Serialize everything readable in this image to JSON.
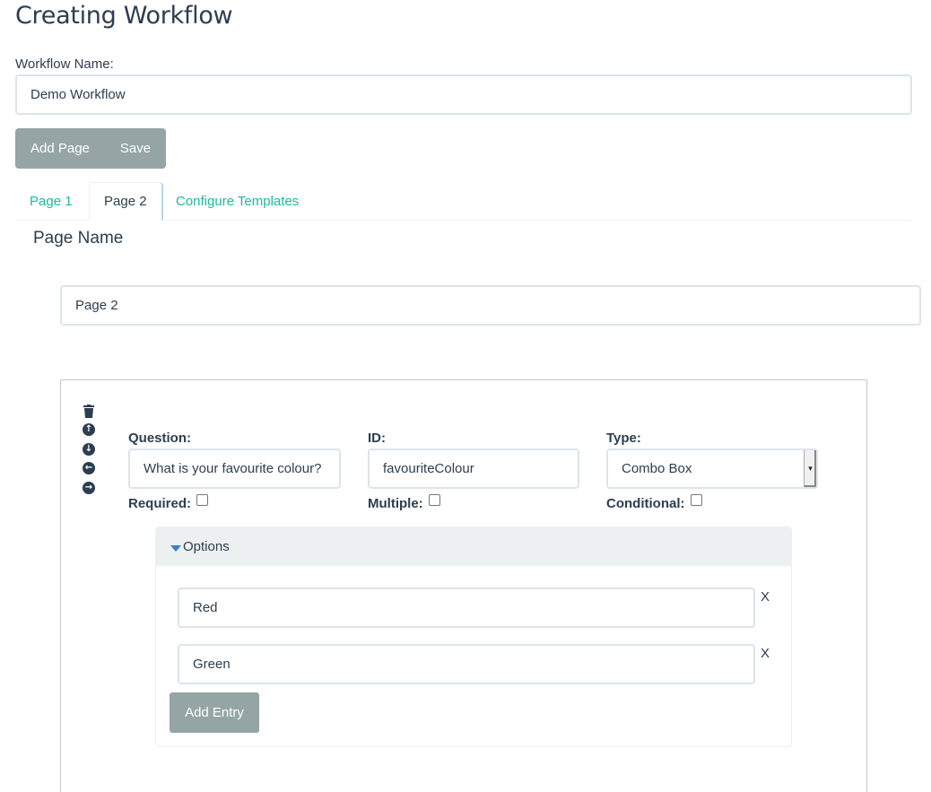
{
  "header": {
    "title": "Creating Workflow"
  },
  "workflow": {
    "name_label": "Workflow Name:",
    "name_value": "Demo Workflow"
  },
  "toolbar": {
    "add_page_label": "Add Page",
    "save_label": "Save"
  },
  "tabs": [
    {
      "label": "Page 1",
      "active": false
    },
    {
      "label": "Page 2",
      "active": true
    },
    {
      "label": "Configure Templates",
      "active": false
    }
  ],
  "page": {
    "name_heading": "Page Name",
    "name_value": "Page 2"
  },
  "question": {
    "icons": [
      "trash-icon",
      "arrow-up-circle-icon",
      "arrow-down-circle-icon",
      "arrow-left-circle-icon",
      "arrow-right-circle-icon"
    ],
    "question_label": "Question:",
    "question_value": "What is your favourite colour?",
    "id_label": "ID:",
    "id_value": "favouriteColour",
    "type_label": "Type:",
    "type_value": "Combo Box",
    "required_label": "Required:",
    "required_checked": false,
    "multiple_label": "Multiple:",
    "multiple_checked": false,
    "conditional_label": "Conditional:",
    "conditional_checked": false
  },
  "options": {
    "heading": "Options",
    "entries": [
      {
        "value": "Red",
        "remove_label": "X"
      },
      {
        "value": "Green",
        "remove_label": "X"
      }
    ],
    "add_entry_label": "Add Entry"
  },
  "colors": {
    "primary": "#2c3e50",
    "accent": "#18bc9c",
    "button_gray": "#95a5a6",
    "panel_bg": "#ecf0f1"
  }
}
